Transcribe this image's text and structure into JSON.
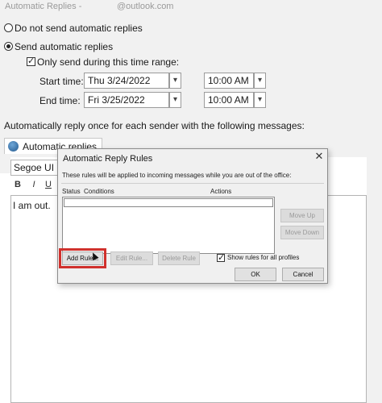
{
  "window": {
    "title": "Automatic Replies -",
    "account": "@outlook.com"
  },
  "options": {
    "no_reply_label": "Do not send automatic replies",
    "send_reply_label": "Send automatic replies",
    "time_range_label": "Only send during this time range:",
    "start_time_label": "Start time:",
    "end_time_label": "End time:",
    "start_date": "Thu 3/24/2022",
    "start_time": "10:00 AM",
    "end_date": "Fri 3/25/2022",
    "end_time": "10:00 AM",
    "message_instruction": "Automatically reply once for each sender with the following messages:"
  },
  "editor": {
    "tab_label": "Automatic replies",
    "font_name": "Segoe UI",
    "format_buttons": [
      "B",
      "I",
      "U"
    ],
    "message_text": "I am out."
  },
  "dialog": {
    "title": "Automatic Reply Rules",
    "close_symbol": "✕",
    "description": "These rules will be applied to incoming messages while you are out of the office:",
    "columns": {
      "status": "Status",
      "conditions": "Conditions",
      "actions": "Actions"
    },
    "move_up": "Move Up",
    "move_down": "Move Down",
    "add_rule": "Add Rule...",
    "edit_rule": "Edit Rule...",
    "delete_rule": "Delete Rule",
    "show_all_profiles": "Show rules for all profiles",
    "ok": "OK",
    "cancel": "Cancel"
  },
  "colors": {
    "highlight": "#d0312d",
    "background": "#f1f1f1"
  }
}
